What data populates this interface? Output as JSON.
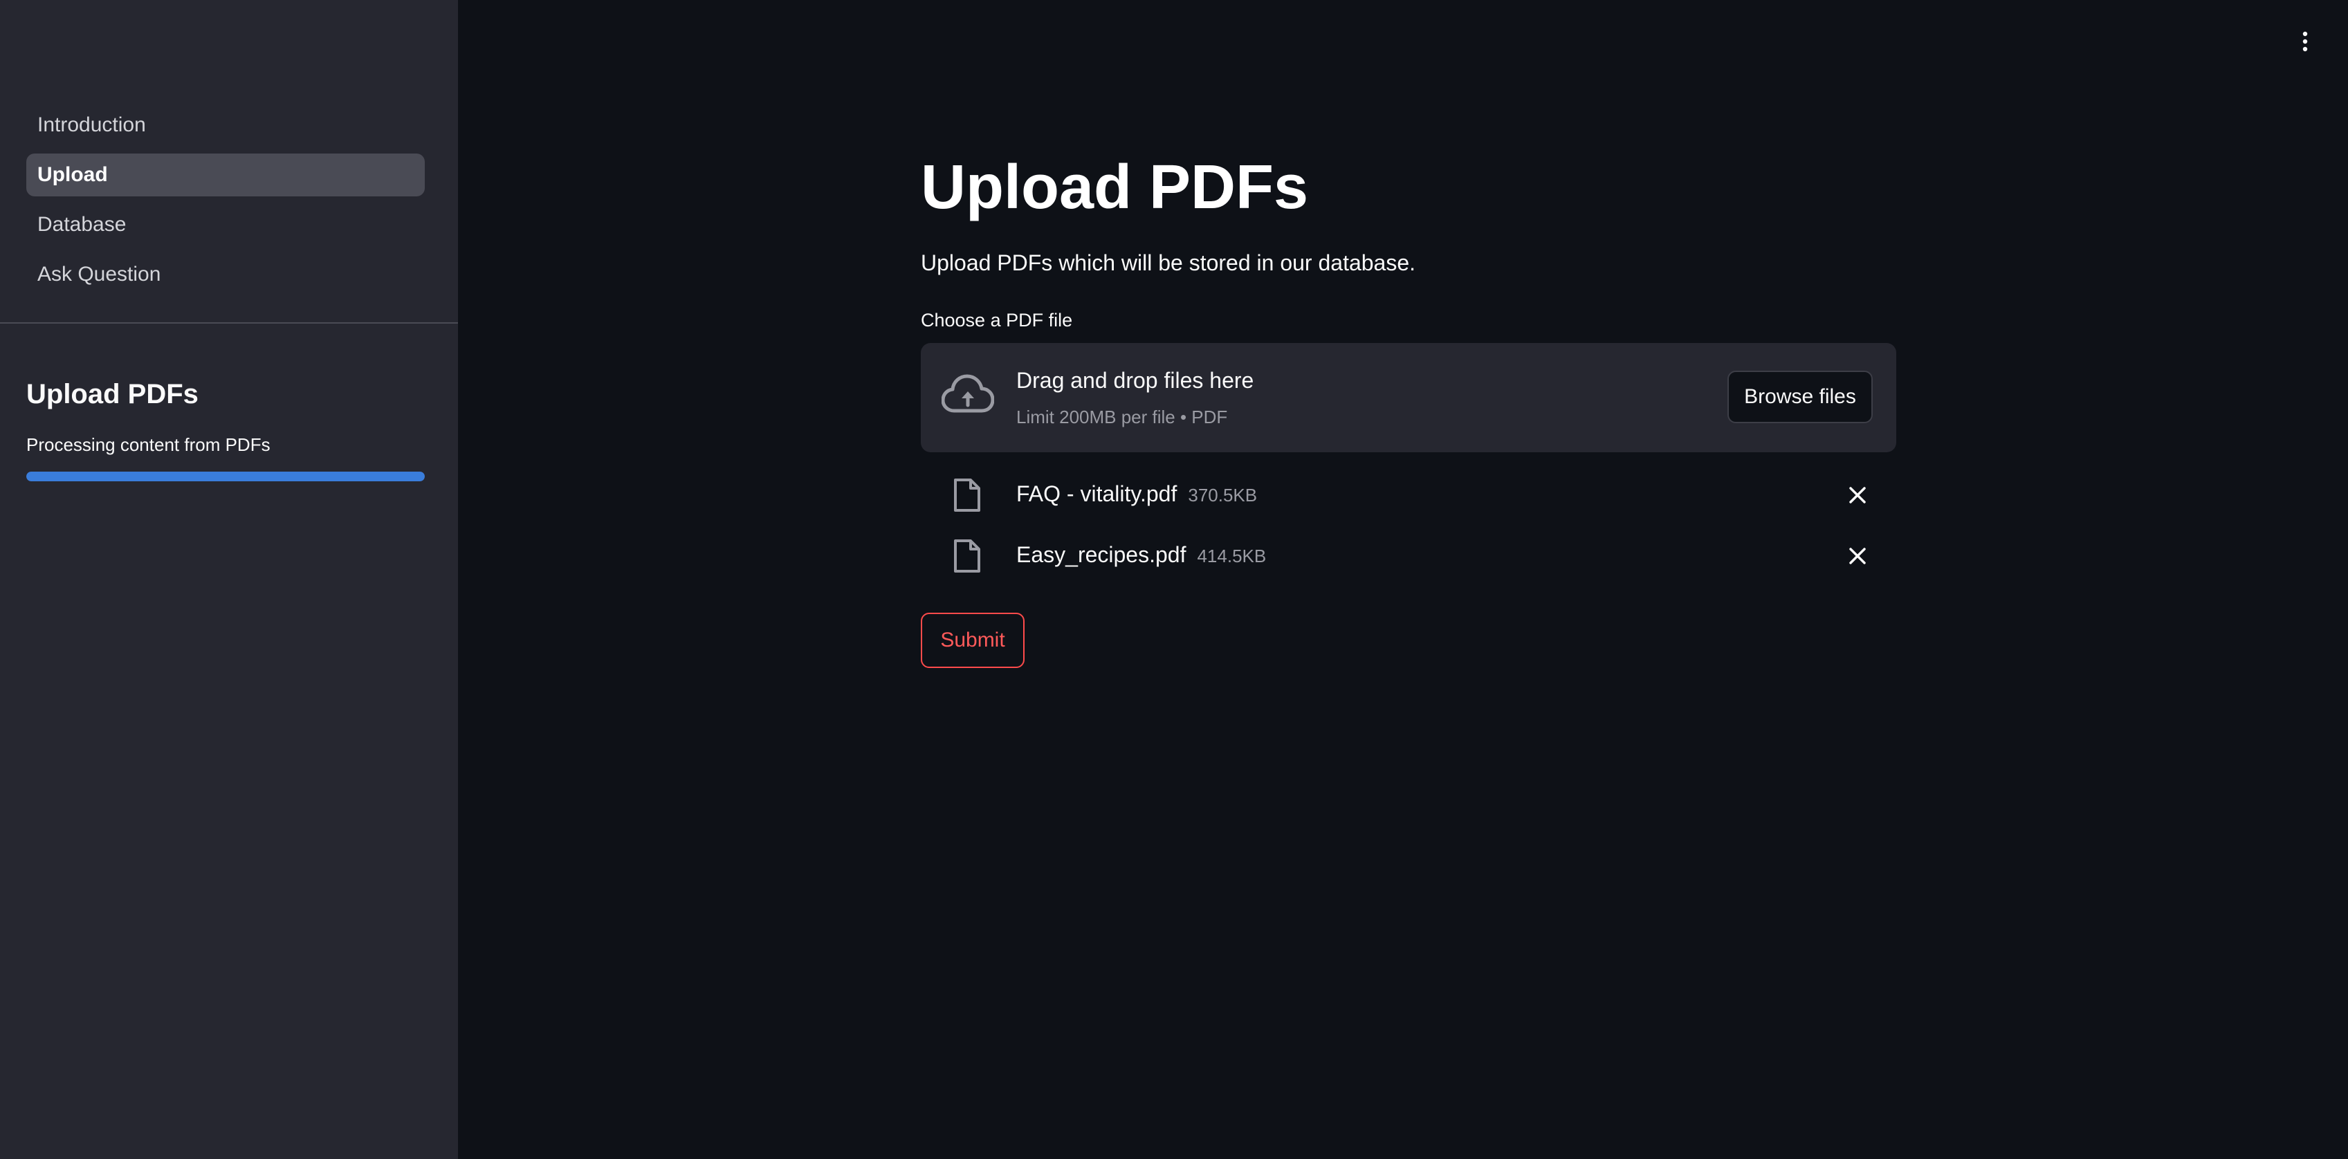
{
  "sidebar": {
    "nav_items": [
      {
        "label": "Introduction",
        "active": false
      },
      {
        "label": "Upload",
        "active": true
      },
      {
        "label": "Database",
        "active": false
      },
      {
        "label": "Ask Question",
        "active": false
      }
    ],
    "section_title": "Upload PDFs",
    "progress_label": "Processing content from PDFs",
    "progress_fraction": 1.0
  },
  "main": {
    "title": "Upload PDFs",
    "description": "Upload PDFs which will be stored in our database.",
    "uploader": {
      "label": "Choose a PDF file",
      "dropzone_title": "Drag and drop files here",
      "dropzone_limit": "Limit 200MB per file • PDF",
      "browse_label": "Browse files",
      "files": [
        {
          "name": "FAQ - vitality.pdf",
          "size": "370.5KB"
        },
        {
          "name": "Easy_recipes.pdf",
          "size": "414.5KB"
        }
      ]
    },
    "submit_label": "Submit"
  },
  "icons": {
    "menu": "vertical-ellipsis-icon",
    "upload": "cloud-upload-icon",
    "file": "file-icon",
    "remove": "close-icon"
  },
  "colors": {
    "background": "#0e1117",
    "sidebar": "#262730",
    "accent": "#ff4b4b",
    "progress": "#3a7ddb"
  }
}
